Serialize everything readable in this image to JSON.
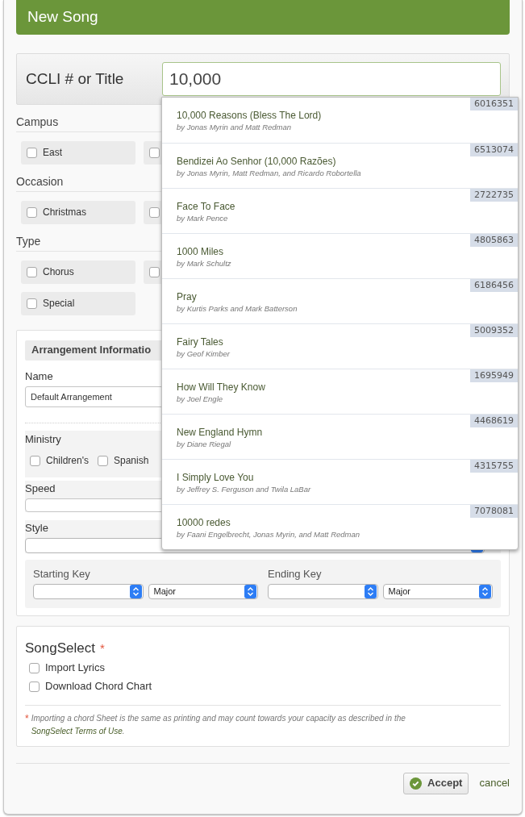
{
  "header": {
    "title": "New Song"
  },
  "search": {
    "label": "CCLI # or Title",
    "value": "10,000"
  },
  "results": [
    {
      "title": "10,000 Reasons (Bless The Lord)",
      "authors": "by Jonas Myrin and Matt Redman",
      "number": "6016351"
    },
    {
      "title": "Bendizei Ao Senhor (10,000 Razões)",
      "authors": "by Jonas Myrin, Matt Redman, and Ricardo Robortella",
      "number": "6513074"
    },
    {
      "title": "Face To Face",
      "authors": "by Mark Pence",
      "number": "2722735"
    },
    {
      "title": "1000 Miles",
      "authors": "by Mark Schultz",
      "number": "4805863"
    },
    {
      "title": "Pray",
      "authors": "by Kurtis Parks and Mark Batterson",
      "number": "6186456"
    },
    {
      "title": "Fairy Tales",
      "authors": "by Geof Kimber",
      "number": "5009352"
    },
    {
      "title": "How Will They Know",
      "authors": "by Joel Engle",
      "number": "1695949"
    },
    {
      "title": "New England Hymn",
      "authors": "by Diane Riegal",
      "number": "4468619"
    },
    {
      "title": "I Simply Love You",
      "authors": "by Jeffrey S. Ferguson and Twila LaBar",
      "number": "4315755"
    },
    {
      "title": "10000 redes",
      "authors": "by Faani Engelbrecht, Jonas Myrin, and Matt Redman",
      "number": "7078081"
    }
  ],
  "groups": [
    {
      "title": "Campus",
      "options": [
        {
          "label": "East",
          "checked": false
        },
        {
          "checked": false
        }
      ]
    },
    {
      "title": "Occasion",
      "options": [
        {
          "label": "Christmas",
          "checked": false
        },
        {
          "checked": false
        }
      ]
    },
    {
      "title": "Type",
      "options": [
        {
          "label": "Chorus",
          "checked": false
        },
        {
          "checked": false
        },
        {
          "label": "Special",
          "checked": false
        }
      ]
    }
  ],
  "arrangement": {
    "title": "Arrangement Informatio",
    "name_label": "Name",
    "name_value": "Default Arrangement",
    "ministry": {
      "label": "Ministry",
      "options": [
        {
          "label": "Children's",
          "checked": false
        },
        {
          "label": "Spanish",
          "checked": false
        }
      ]
    },
    "speed_label": "Speed",
    "style_label": "Style",
    "keys": [
      {
        "label": "Starting Key",
        "mode": "Major"
      },
      {
        "label": "Ending Key",
        "mode": "Major"
      }
    ]
  },
  "songselect": {
    "title": "SongSelect",
    "required_mark": "*",
    "options": [
      {
        "label": "Import Lyrics",
        "checked": false
      },
      {
        "label": "Download Chord Chart",
        "checked": false
      }
    ],
    "note_mark": "*",
    "note": "Importing a chord Sheet is the same as printing and may count towards your capacity as described in the",
    "note_link": "SongSelect Terms of Use",
    "note_end": "."
  },
  "actions": {
    "accept": "Accept",
    "cancel": "cancel"
  }
}
